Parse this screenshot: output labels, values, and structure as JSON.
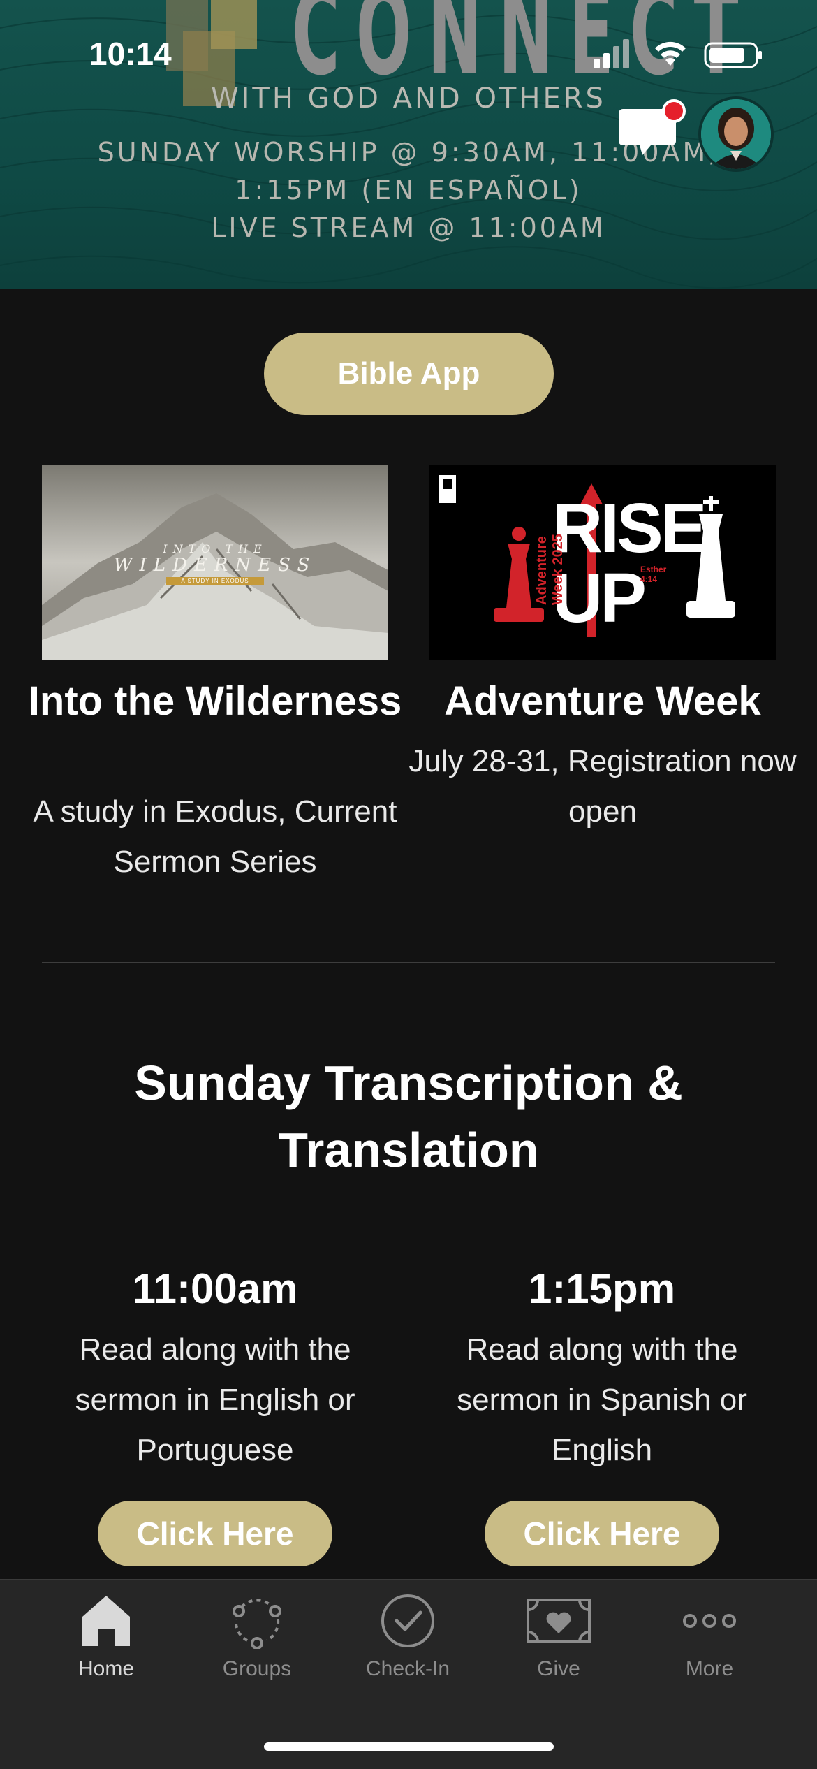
{
  "status_bar": {
    "time": "10:14"
  },
  "banner": {
    "headline": "CONNECT",
    "subline": "WITH GOD AND OTHERS",
    "schedule_line1": "SUNDAY WORSHIP @ 9:30AM, 11:00AM,",
    "schedule_line2": "1:15PM (EN ESPAÑOL)",
    "schedule_line3": "LIVE STREAM @ 11:00AM",
    "background_color": "#14534d"
  },
  "actions": {
    "bible_app_label": "Bible App",
    "accent_color": "#c9bc86"
  },
  "cards": [
    {
      "image_text_line1": "INTO THE",
      "image_text_line2": "WILDERNESS",
      "image_text_line3": "A STUDY IN EXODUS",
      "title": "Into the Wilderness",
      "description": "A study in Exodus, Current Sermon Series"
    },
    {
      "image_text_main": "RISE UP",
      "image_text_side": "Adventure Week 2025",
      "image_text_ref": "Esther 4:14",
      "title": "Adventure Week",
      "description": "July 28-31, Registration now open"
    }
  ],
  "transcription": {
    "title": "Sunday Transcription & Translation",
    "services": [
      {
        "time": "11:00am",
        "description": "Read along with the sermon in English or Portuguese",
        "button": "Click Here"
      },
      {
        "time": "1:15pm",
        "description": "Read along with the sermon in Spanish or English",
        "button": "Click Here"
      }
    ]
  },
  "tabbar": {
    "items": [
      {
        "label": "Home",
        "icon": "home-icon",
        "active": true
      },
      {
        "label": "Groups",
        "icon": "groups-icon",
        "active": false
      },
      {
        "label": "Check-In",
        "icon": "check-in-icon",
        "active": false
      },
      {
        "label": "Give",
        "icon": "give-icon",
        "active": false
      },
      {
        "label": "More",
        "icon": "more-icon",
        "active": false
      }
    ]
  }
}
